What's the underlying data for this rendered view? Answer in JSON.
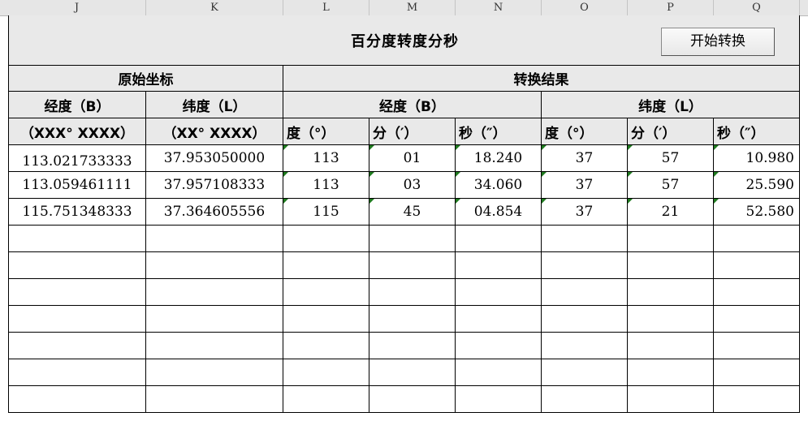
{
  "columns": [
    "J",
    "K",
    "L",
    "M",
    "N",
    "O",
    "P",
    "Q"
  ],
  "title": "百分度转度分秒",
  "button_label": "开始转换",
  "headers": {
    "original": "原始坐标",
    "result": "转换结果",
    "lon": "经度（B）",
    "lat": "纬度（L）",
    "fmt_lon": "（XXX° XXXX）",
    "fmt_lat": "（XX° XXXX）",
    "deg": "度（°）",
    "min": "分（′）",
    "sec": "秒（″）"
  },
  "rows": [
    {
      "lon": "113.021733333",
      "lat": "37.953050000",
      "b_deg": "113",
      "b_min": "01",
      "b_sec": "18.240",
      "l_deg": "37",
      "l_min": "57",
      "l_sec": "10.980"
    },
    {
      "lon": "113.059461111",
      "lat": "37.957108333",
      "b_deg": "113",
      "b_min": "03",
      "b_sec": "34.060",
      "l_deg": "37",
      "l_min": "57",
      "l_sec": "25.590"
    },
    {
      "lon": "115.751348333",
      "lat": "37.364605556",
      "b_deg": "115",
      "b_min": "45",
      "b_sec": "04.854",
      "l_deg": "37",
      "l_min": "21",
      "l_sec": "52.580"
    }
  ],
  "empty_row_count": 7
}
